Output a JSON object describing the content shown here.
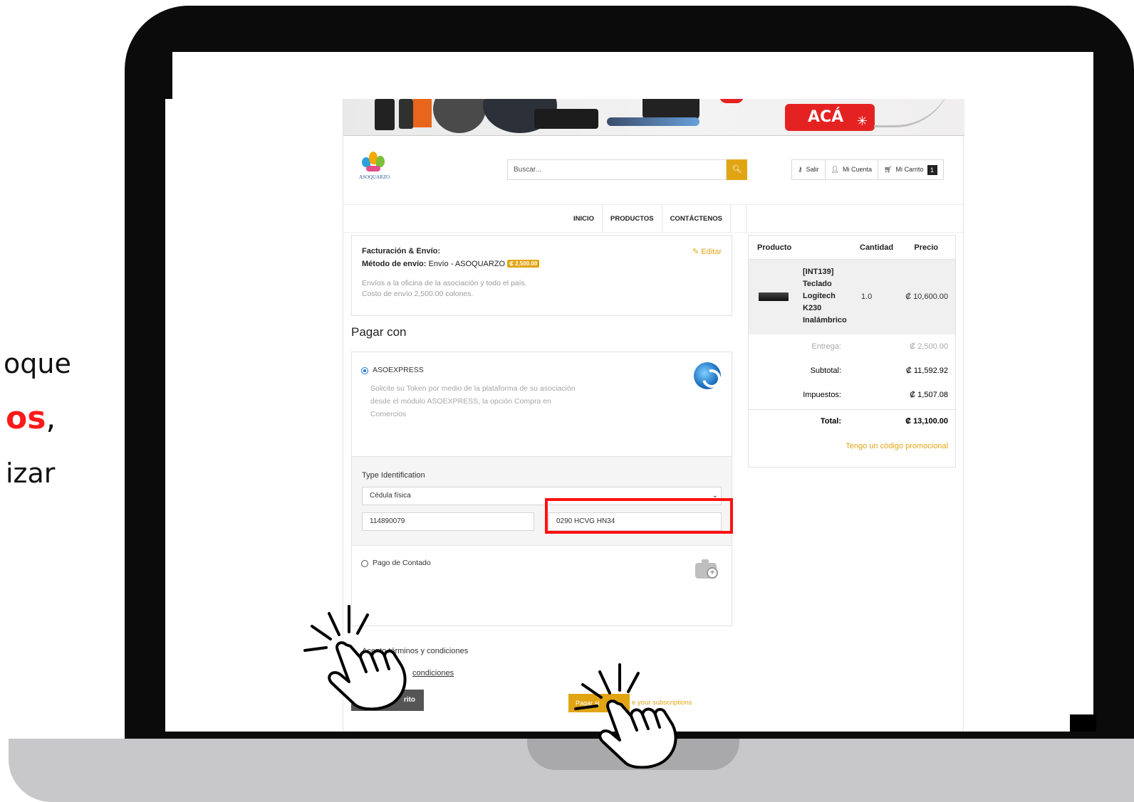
{
  "side_text": {
    "line1": "oque",
    "line2": "os",
    "line2_comma": ",",
    "line3": "izar"
  },
  "banner": {
    "cta_label": "ACÁ"
  },
  "header": {
    "logo_text": "ASOQUARZO",
    "search_placeholder": "Buscar...",
    "logout_label": "Salir",
    "account_label": "Mi Cuenta",
    "cart_label": "Mi Carrito",
    "cart_count": "1"
  },
  "nav": {
    "items": [
      {
        "label": "INICIO"
      },
      {
        "label": "PRODUCTOS"
      },
      {
        "label": "CONTÁCTENOS"
      }
    ]
  },
  "billing": {
    "title": "Facturación & Envío:",
    "method_label": "Método de envío:",
    "method_value": "Envío - ASOQUARZO",
    "method_price": "₡ 2,500.00",
    "edit_label": "Editar",
    "desc_line1": "Envíos a la oficina de la asociación y todo el país.",
    "desc_line2": "Costo de envío 2,500.00 colones."
  },
  "payment": {
    "title": "Pagar con",
    "option1_label": "ASOEXPRESS",
    "option1_desc": "Solicite su Token por medio de la plataforma de su asociación desde el módulo ASOEXPRESS, la opción Compra en Comercios",
    "id_type_label": "Type Identification",
    "id_type_value": "Cédula física",
    "id_number_value": "114890079",
    "token_value": "0290 HCVG HN34",
    "option2_label": "Pago de Contado",
    "terms_label": "Acepto términos y condiciones",
    "terms_link": "condiciones",
    "back_label": "rito",
    "pay_label": "Pagar al",
    "subscriptions_link": "e your subscriptions"
  },
  "cart": {
    "col_product": "Producto",
    "col_qty": "Cantidad",
    "col_price": "Precio",
    "item": {
      "name": "[INT139] Teclado Logitech K230 Inalámbrico",
      "qty": "1.0",
      "price": "₡ 10,600.00"
    },
    "delivery_label": "Entrega:",
    "delivery_value": "₡ 2,500.00",
    "subtotal_label": "Subtotal:",
    "subtotal_value": "₡ 11,592.92",
    "tax_label": "Impuestos:",
    "tax_value": "₡ 1,507.08",
    "total_label": "Total:",
    "total_value": "₡ 13,100.00",
    "promo_link": "Tengo un código promocional"
  },
  "colors": {
    "accent": "#e1a514",
    "highlight": "#ff1111",
    "emphasis_text": "#ff1a1a"
  }
}
